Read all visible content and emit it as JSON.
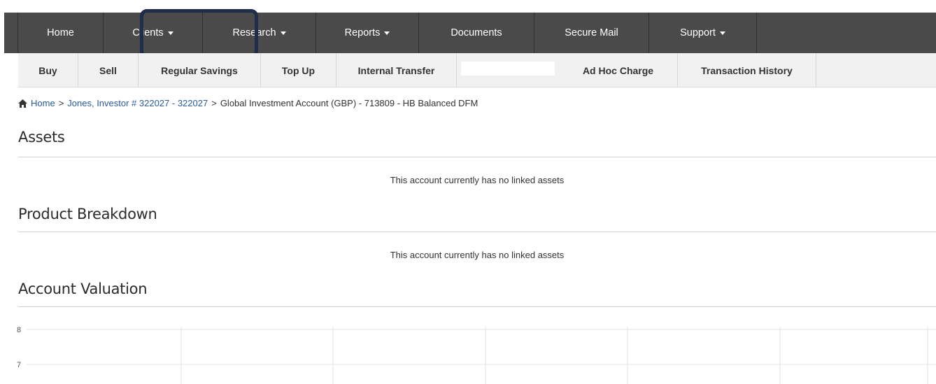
{
  "top_nav": {
    "items": [
      {
        "label": "Home",
        "dropdown": false
      },
      {
        "label": "Clients",
        "dropdown": true
      },
      {
        "label": "Research",
        "dropdown": true
      },
      {
        "label": "Reports",
        "dropdown": true
      },
      {
        "label": "Documents",
        "dropdown": false
      },
      {
        "label": "Secure Mail",
        "dropdown": false
      },
      {
        "label": "Support",
        "dropdown": true
      }
    ]
  },
  "sub_nav": {
    "items": [
      "Buy",
      "Sell",
      "Regular Savings",
      "Top Up",
      "Internal Transfer",
      "",
      "Ad Hoc Charge",
      "Transaction History"
    ]
  },
  "breadcrumb": {
    "home": "Home",
    "client": "Jones, Investor # 322027 - 322027",
    "account": "Global Investment Account (GBP) - 713809 - HB Balanced DFM",
    "separator": ">"
  },
  "sections": {
    "assets": {
      "title": "Assets",
      "message": "This account currently has no linked assets"
    },
    "product_breakdown": {
      "title": "Product Breakdown",
      "message": "This account currently has no linked assets"
    },
    "account_valuation": {
      "title": "Account Valuation"
    }
  },
  "chart_data": {
    "type": "line",
    "title": "",
    "xlabel": "",
    "ylabel": "",
    "y_ticks": [
      "8",
      "7"
    ],
    "series": [],
    "grid": true
  },
  "colors": {
    "nav_bg": "#4a4a4a",
    "subnav_bg": "#f1f1f1",
    "link": "#2a5b9b",
    "highlight_border": "#1f2d4a"
  }
}
